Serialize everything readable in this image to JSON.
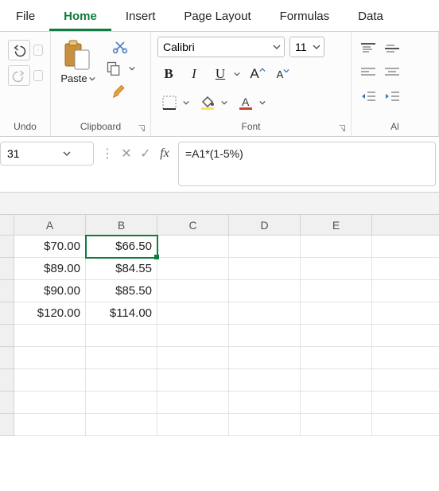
{
  "tabs": {
    "file": "File",
    "home": "Home",
    "insert": "Insert",
    "pagelayout": "Page Layout",
    "formulas": "Formulas",
    "data": "Data"
  },
  "groups": {
    "undo": "Undo",
    "clipboard": "Clipboard",
    "font": "Font",
    "alignment": "Al"
  },
  "paste": {
    "label": "Paste"
  },
  "font": {
    "name": "Calibri",
    "size": "11"
  },
  "namebox": "31",
  "formula": "=A1*(1-5%)",
  "columns": [
    "A",
    "B",
    "C",
    "D",
    "E",
    ""
  ],
  "cells": {
    "a1": "$70.00",
    "b1": "$66.50",
    "a2": "$89.00",
    "b2": "$84.55",
    "a3": "$90.00",
    "b3": "$85.50",
    "a4": "$120.00",
    "b4": "$114.00"
  }
}
